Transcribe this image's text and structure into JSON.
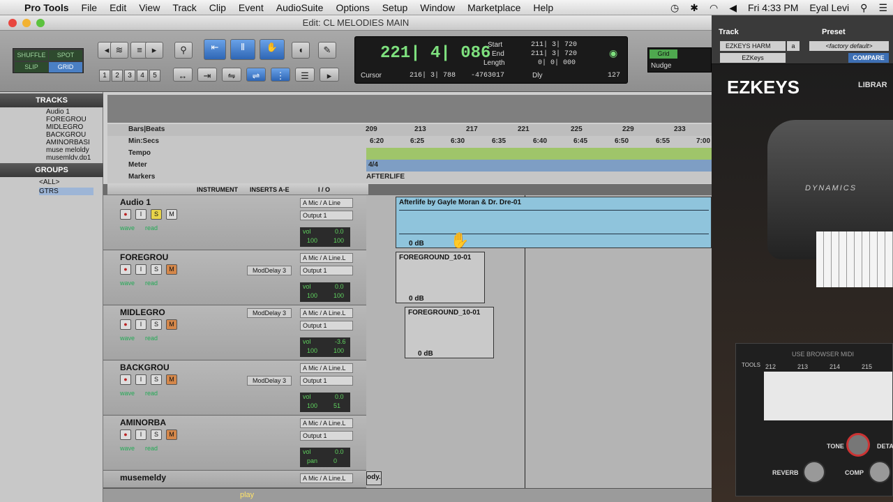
{
  "menubar": {
    "app": "Pro Tools",
    "items": [
      "File",
      "Edit",
      "View",
      "Track",
      "Clip",
      "Event",
      "AudioSuite",
      "Options",
      "Setup",
      "Window",
      "Marketplace",
      "Help"
    ],
    "clock": "Fri 4:33 PM",
    "user": "Eyal Levi"
  },
  "window": {
    "title": "Edit: CL MELODIES MAIN"
  },
  "modes": {
    "shuffle": "SHUFFLE",
    "spot": "SPOT",
    "slip": "SLIP",
    "grid": "GRID"
  },
  "counter": {
    "main": "221| 4| 086",
    "start_label": "Start",
    "start": "211| 3| 720",
    "end_label": "End",
    "end": "211| 3| 720",
    "length_label": "Length",
    "length": "0| 0| 000",
    "cursor_label": "Cursor",
    "cursor": "216| 3| 788",
    "cursor_sample": "-4763017",
    "dly": "Dly",
    "tempo": "127"
  },
  "grid": {
    "grid_label": "Grid",
    "nudge_label": "Nudge"
  },
  "left": {
    "tracks_hdr": "TRACKS",
    "tracks": [
      "Audio 1",
      "FOREGROU",
      "MIDLEGRO",
      "BACKGROU",
      "AMINORBASI",
      "muse meloldy",
      "musemldy.dp1"
    ],
    "groups_hdr": "GROUPS",
    "groups": [
      "<ALL>",
      "GTRS"
    ]
  },
  "ruler": {
    "bars_label": "Bars|Beats",
    "minsec_label": "Min:Secs",
    "tempo_label": "Tempo",
    "meter_label": "Meter",
    "markers_label": "Markers",
    "bars": [
      "209",
      "213",
      "217",
      "221",
      "225",
      "229",
      "233"
    ],
    "times": [
      "6:20",
      "6:25",
      "6:30",
      "6:35",
      "6:40",
      "6:45",
      "6:50",
      "6:55",
      "7:00"
    ],
    "meter": "4/4",
    "marker": "AFTERLIFE"
  },
  "columns": {
    "instrument": "INSTRUMENT",
    "inserts": "INSERTS A-E",
    "io": "I / O"
  },
  "tracks": [
    {
      "name": "Audio 1",
      "insert": "",
      "in": "A Mic / A Line",
      "out": "Output 1",
      "vol": "0.0",
      "pan_l": "100",
      "pan_r": "100"
    },
    {
      "name": "FOREGROU",
      "insert": "ModDelay 3",
      "in": "A Mic / A Line.L",
      "out": "Output 1",
      "vol": "0.0",
      "pan_l": "100",
      "pan_r": "100"
    },
    {
      "name": "MIDLEGRO",
      "insert": "ModDelay 3",
      "in": "A Mic / A Line.L",
      "out": "Output 1",
      "vol": "-3.6",
      "pan_l": "100",
      "pan_r": "100"
    },
    {
      "name": "BACKGROU",
      "insert": "ModDelay 3",
      "in": "A Mic / A Line.L",
      "out": "Output 1",
      "vol": "0.0",
      "pan_l": "100",
      "pan_r": "51"
    },
    {
      "name": "AMINORBA",
      "insert": "",
      "in": "A Mic / A Line.L",
      "out": "Output 1",
      "vol": "0.0",
      "pan_l": "pan",
      "pan_r": "0"
    },
    {
      "name": "musemeldy",
      "insert": "",
      "in": "A Mic / A Line.L",
      "out": "",
      "vol": "",
      "pan_l": "",
      "pan_r": ""
    }
  ],
  "labels": {
    "vol": "vol",
    "wave": "wave",
    "read": "read"
  },
  "clips": [
    {
      "name": "Afterlife by Gayle Moran & Dr. Dre-01",
      "gain": "0 dB"
    },
    {
      "name": "FOREGROUND_10-01",
      "gain": "0 dB"
    },
    {
      "name": "FOREGROUND_10-01",
      "gain": "0 dB"
    },
    {
      "name": "ody.",
      "gain": ""
    }
  ],
  "bottom": {
    "play": "play"
  },
  "plugin": {
    "track_label": "Track",
    "preset_label": "Preset",
    "track_name": "EZKEYS HARM",
    "track_a": "a",
    "preset_name": "<factory default>",
    "plugin_name": "EZKeys",
    "compare": "COMPARE",
    "brand": "EZKEYS",
    "library": "LIBRAR",
    "dynamics": "DYNAMICS",
    "use_browser": "USE BROWSER MIDI",
    "tools": "TOOLS",
    "bars": [
      "212",
      "213",
      "214",
      "215"
    ],
    "tone": "TONE",
    "detail": "DETA",
    "reverb": "REVERB",
    "comp": "COMP"
  }
}
